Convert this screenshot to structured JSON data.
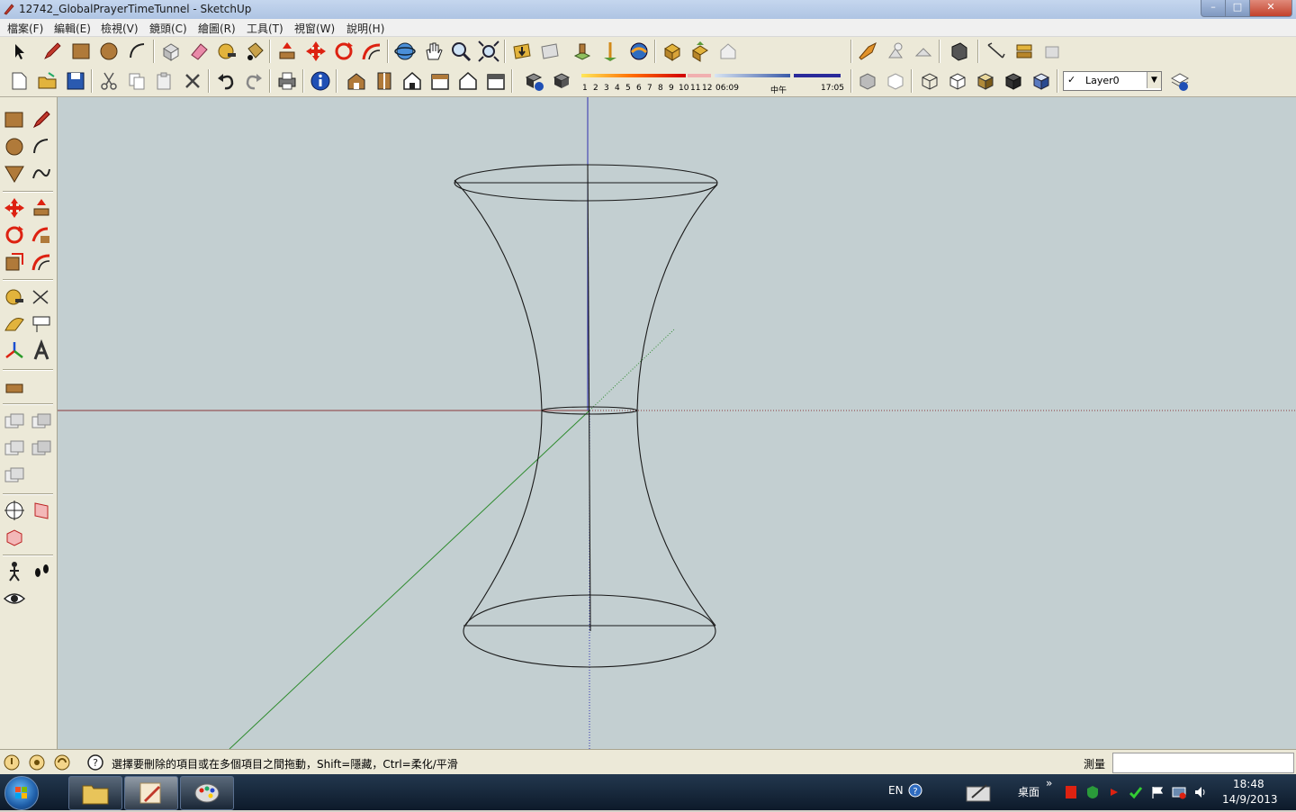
{
  "window": {
    "title": "12742_GlobalPrayerTimeTunnel - SketchUp",
    "minimize": "–",
    "maximize": "□",
    "close": "✕"
  },
  "menu": [
    "檔案(F)",
    "編輯(E)",
    "檢視(V)",
    "鏡頭(C)",
    "繪圖(R)",
    "工具(T)",
    "視窗(W)",
    "說明(H)"
  ],
  "shadow_settings": {
    "months": [
      "1",
      "2",
      "3",
      "4",
      "5",
      "6",
      "7",
      "8",
      "9",
      "10",
      "11",
      "12"
    ],
    "sunrise": "06:09",
    "noon": "中午",
    "sunset": "17:05"
  },
  "layer": {
    "name": "Layer0",
    "checked": "✓"
  },
  "status": {
    "hint": "選擇要刪除的項目或在多個項目之間拖動，Shift=隱藏，Ctrl=柔化/平滑",
    "measure_label": "測量",
    "measure_value": ""
  },
  "taskbar": {
    "lang": "EN",
    "desktop": "桌面",
    "more": "»",
    "time": "18:48",
    "date": "14/9/2013"
  },
  "colors": {
    "viewport_bg": "#c3cfd1",
    "axis_red": "#8b3a3a",
    "axis_green": "#2e8b2e",
    "axis_blue": "#2f2fb0",
    "edge": "#1a1a1a"
  },
  "icons": {
    "toolbar_row1": [
      "select-icon",
      "pencil-icon",
      "rectangle-icon",
      "circle-icon",
      "arc-icon",
      "make-component-icon",
      "eraser-icon",
      "tape-measure-icon",
      "paint-bucket-icon",
      "push-pull-icon",
      "move-icon",
      "rotate-icon",
      "follow-me-icon",
      "orbit-icon",
      "pan-icon",
      "zoom-icon",
      "zoom-extents-icon",
      "get-models-icon",
      "share-model-icon",
      "place-model-icon",
      "photo-textures-icon"
    ],
    "toolbar_row2": [
      "new-icon",
      "open-icon",
      "save-icon",
      "cut-icon",
      "copy-icon",
      "paste-icon",
      "delete-icon",
      "undo-icon",
      "redo-icon",
      "print-icon",
      "model-info-icon",
      "iso-view-icon",
      "top-view-icon",
      "front-view-icon",
      "right-view-icon",
      "back-view-icon",
      "left-view-icon",
      "shadow-settings-icon",
      "display-shadows-icon"
    ]
  }
}
